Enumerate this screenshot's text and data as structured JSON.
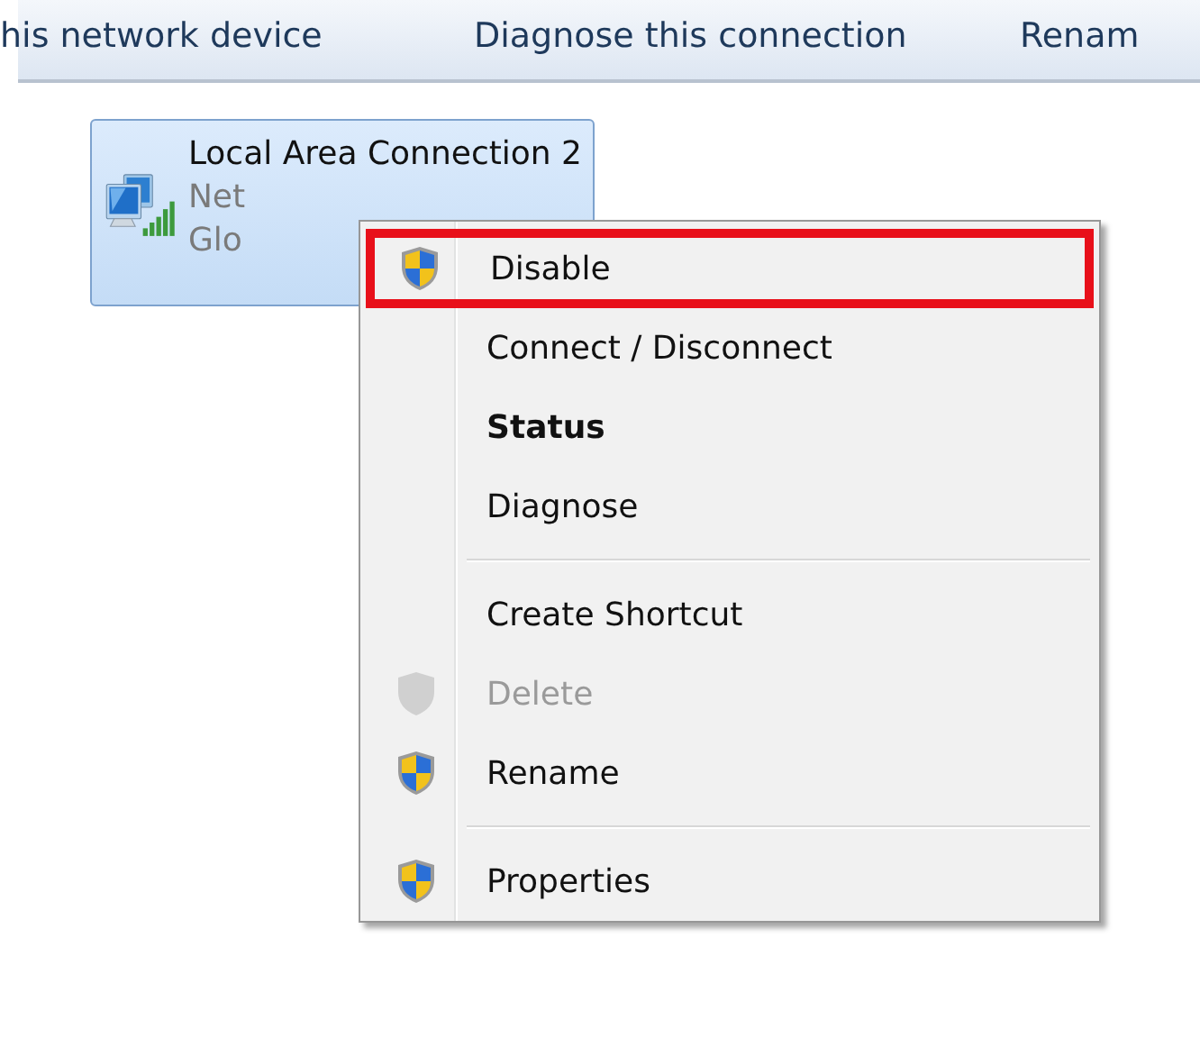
{
  "toolbar": {
    "items": [
      "his network device",
      "Diagnose this connection",
      "Renam"
    ]
  },
  "connection": {
    "name": "Local Area Connection 2",
    "network": "Net",
    "device": "Glo",
    "selected": true
  },
  "context_menu": {
    "items": [
      {
        "label": "Disable",
        "kind": "shield",
        "disabled": false,
        "default": false,
        "highlighted": true
      },
      {
        "label": "Connect / Disconnect",
        "kind": "plain",
        "disabled": false,
        "default": false,
        "highlighted": false
      },
      {
        "label": "Status",
        "kind": "plain",
        "disabled": false,
        "default": true,
        "highlighted": false
      },
      {
        "label": "Diagnose",
        "kind": "plain",
        "disabled": false,
        "default": false,
        "highlighted": false
      },
      {
        "kind": "separator"
      },
      {
        "label": "Create Shortcut",
        "kind": "plain",
        "disabled": false,
        "default": false,
        "highlighted": false
      },
      {
        "label": "Delete",
        "kind": "shield",
        "disabled": true,
        "default": false,
        "highlighted": false
      },
      {
        "label": "Rename",
        "kind": "shield",
        "disabled": false,
        "default": false,
        "highlighted": false
      },
      {
        "kind": "separator"
      },
      {
        "label": "Properties",
        "kind": "shield",
        "disabled": false,
        "default": false,
        "highlighted": false
      }
    ]
  }
}
